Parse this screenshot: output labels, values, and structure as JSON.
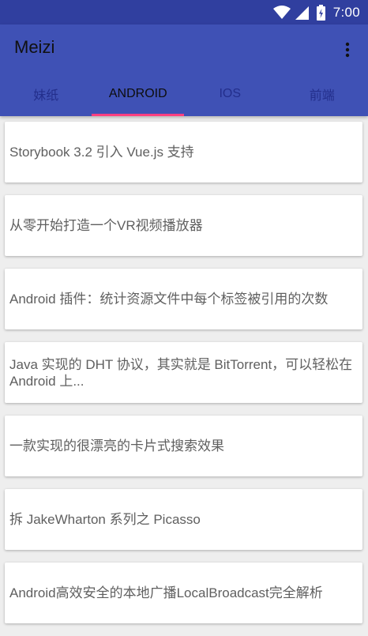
{
  "status_bar": {
    "time": "7:00",
    "icons": [
      "wifi-icon",
      "signal-icon",
      "battery-charging-icon"
    ]
  },
  "app_bar": {
    "title": "Meizi",
    "menu_icon": "more-vert-icon"
  },
  "tabs": [
    {
      "label": "妹纸",
      "active": false
    },
    {
      "label": "ANDROID",
      "active": true
    },
    {
      "label": "IOS",
      "active": false
    },
    {
      "label": "前端",
      "active": false
    }
  ],
  "colors": {
    "status_bar": "#303f9f",
    "app_bar": "#3f51b5",
    "tab_indicator": "#ff4081",
    "background": "#eeeeee",
    "card": "#ffffff"
  },
  "articles": [
    {
      "title": "Storybook 3.2 引入 Vue.js 支持"
    },
    {
      "title": "从零开始打造一个VR视频播放器"
    },
    {
      "title": "Android 插件：统计资源文件中每个标签被引用的次数"
    },
    {
      "title": "Java 实现的 DHT 协议，其实就是 BitTorrent，可以轻松在 Android 上..."
    },
    {
      "title": "一款实现的很漂亮的卡片式搜索效果"
    },
    {
      "title": "拆 JakeWharton 系列之 Picasso"
    },
    {
      "title": "Android高效安全的本地广播LocalBroadcast完全解析"
    }
  ]
}
